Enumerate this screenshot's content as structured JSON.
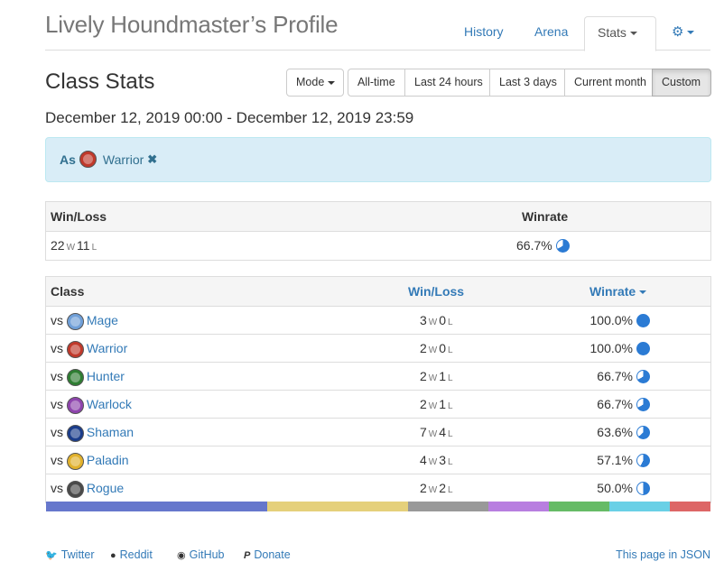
{
  "header": {
    "title": "Lively Houndmaster’s Profile",
    "tabs": [
      {
        "label": "History",
        "active": false
      },
      {
        "label": "Arena",
        "active": false
      },
      {
        "label": "Stats",
        "active": true
      }
    ]
  },
  "section_title": "Class Stats",
  "filters": {
    "mode_label": "Mode",
    "ranges": [
      "All-time",
      "Last 24 hours",
      "Last 3 days",
      "Current month",
      "Custom"
    ],
    "active_range": "Custom"
  },
  "date_range": "December 12, 2019 00:00 - December 12, 2019 23:59",
  "alert": {
    "prefix": "As",
    "class_name": "Warrior",
    "remove_glyph": "✖"
  },
  "summary": {
    "headers": {
      "winloss": "Win/Loss",
      "winrate": "Winrate"
    },
    "wins": "22",
    "losses": "11",
    "win_suffix": "W",
    "loss_suffix": "L",
    "winrate": "66.7%",
    "winrate_value": 0.667
  },
  "class_table": {
    "headers": {
      "class": "Class",
      "winloss": "Win/Loss",
      "winrate": "Winrate"
    },
    "vs_prefix": "vs",
    "rows": [
      {
        "name": "Mage",
        "icon": "mage-icon",
        "color": "#6f9fd8",
        "wins": "3",
        "losses": "0",
        "winrate": "100.0%",
        "winrate_value": 1.0
      },
      {
        "name": "Warrior",
        "icon": "warrior-icon",
        "color": "#c0392b",
        "wins": "2",
        "losses": "0",
        "winrate": "100.0%",
        "winrate_value": 1.0
      },
      {
        "name": "Hunter",
        "icon": "hunter-icon",
        "color": "#2e7d32",
        "wins": "2",
        "losses": "1",
        "winrate": "66.7%",
        "winrate_value": 0.667
      },
      {
        "name": "Warlock",
        "icon": "warlock-icon",
        "color": "#8e44ad",
        "wins": "2",
        "losses": "1",
        "winrate": "66.7%",
        "winrate_value": 0.667
      },
      {
        "name": "Shaman",
        "icon": "shaman-icon",
        "color": "#1a3c8a",
        "wins": "7",
        "losses": "4",
        "winrate": "63.6%",
        "winrate_value": 0.636
      },
      {
        "name": "Paladin",
        "icon": "paladin-icon",
        "color": "#e1b12c",
        "wins": "4",
        "losses": "3",
        "winrate": "57.1%",
        "winrate_value": 0.571
      },
      {
        "name": "Rogue",
        "icon": "rogue-icon",
        "color": "#4a4a4a",
        "wins": "2",
        "losses": "2",
        "winrate": "50.0%",
        "winrate_value": 0.5
      }
    ]
  },
  "class_distribution": [
    {
      "class": "Shaman",
      "share": 0.333,
      "color": "#6677cc"
    },
    {
      "class": "Paladin",
      "share": 0.212,
      "color": "#e5d07b"
    },
    {
      "class": "Rogue",
      "share": 0.121,
      "color": "#999999"
    },
    {
      "class": "Warlock",
      "share": 0.091,
      "color": "#b87ee0"
    },
    {
      "class": "Hunter",
      "share": 0.091,
      "color": "#66bb66"
    },
    {
      "class": "Mage",
      "share": 0.091,
      "color": "#6ad0e6"
    },
    {
      "class": "Warrior",
      "share": 0.061,
      "color": "#dd6666"
    }
  ],
  "footer": {
    "links": [
      "Twitter",
      "Reddit",
      "GitHub",
      "Donate"
    ],
    "json_link": "This page in JSON"
  },
  "colors": {
    "link": "#337ab7",
    "pie": "#2b7bd4",
    "alert_bg": "#d9edf7"
  }
}
